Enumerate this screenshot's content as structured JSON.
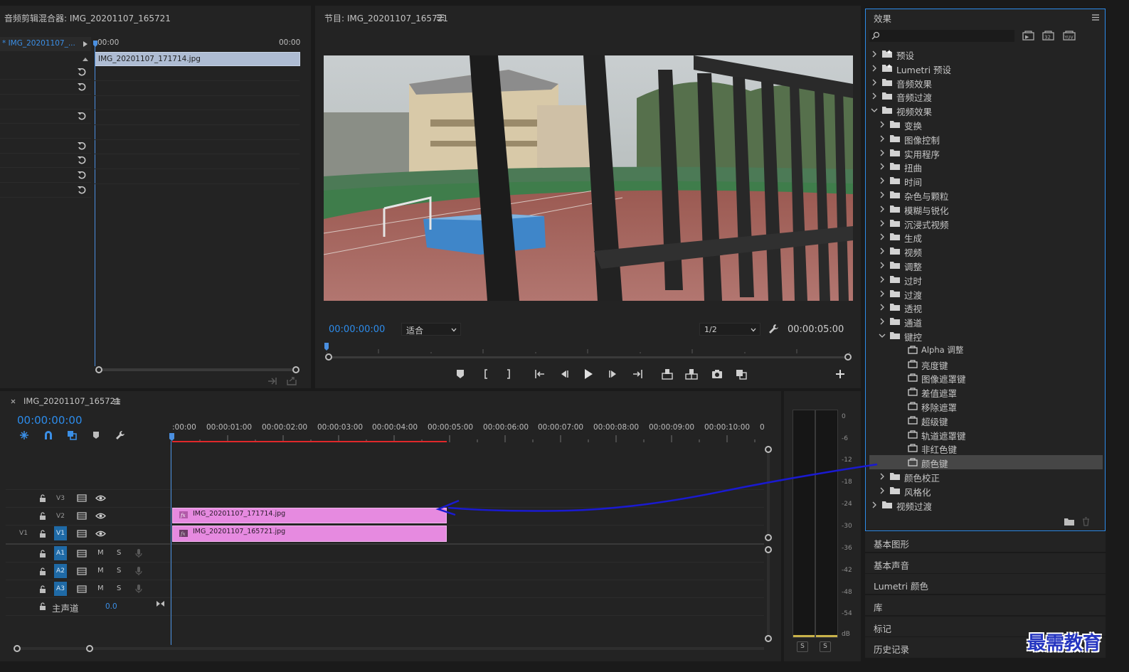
{
  "audio_mixer": {
    "title": "音频剪辑混合器: IMG_20201107_165721",
    "sequence_item": "* IMG_20201107_...",
    "time_start": "00:00",
    "time_end": "00:00",
    "clip_name": "IMG_20201107_171714.jpg"
  },
  "program": {
    "title": "节目: IMG_20201107_165721",
    "timecode": "00:00:00:00",
    "zoom_select": "适合",
    "resolution_select": "1/2",
    "duration": "00:00:05:00"
  },
  "effects": {
    "title": "效果",
    "search_placeholder": "",
    "items": [
      {
        "label": "预设",
        "level": 0,
        "expanded": false,
        "kind": "special-folder"
      },
      {
        "label": "Lumetri 预设",
        "level": 0,
        "expanded": false,
        "kind": "special-folder"
      },
      {
        "label": "音频效果",
        "level": 0,
        "expanded": false,
        "kind": "folder"
      },
      {
        "label": "音频过渡",
        "level": 0,
        "expanded": false,
        "kind": "folder"
      },
      {
        "label": "视频效果",
        "level": 0,
        "expanded": true,
        "kind": "folder"
      },
      {
        "label": "变换",
        "level": 1,
        "expanded": false,
        "kind": "folder"
      },
      {
        "label": "图像控制",
        "level": 1,
        "expanded": false,
        "kind": "folder"
      },
      {
        "label": "实用程序",
        "level": 1,
        "expanded": false,
        "kind": "folder"
      },
      {
        "label": "扭曲",
        "level": 1,
        "expanded": false,
        "kind": "folder"
      },
      {
        "label": "时间",
        "level": 1,
        "expanded": false,
        "kind": "folder"
      },
      {
        "label": "杂色与颗粒",
        "level": 1,
        "expanded": false,
        "kind": "folder"
      },
      {
        "label": "模糊与锐化",
        "level": 1,
        "expanded": false,
        "kind": "folder"
      },
      {
        "label": "沉浸式视频",
        "level": 1,
        "expanded": false,
        "kind": "folder"
      },
      {
        "label": "生成",
        "level": 1,
        "expanded": false,
        "kind": "folder"
      },
      {
        "label": "视频",
        "level": 1,
        "expanded": false,
        "kind": "folder"
      },
      {
        "label": "调整",
        "level": 1,
        "expanded": false,
        "kind": "folder"
      },
      {
        "label": "过时",
        "level": 1,
        "expanded": false,
        "kind": "folder"
      },
      {
        "label": "过渡",
        "level": 1,
        "expanded": false,
        "kind": "folder"
      },
      {
        "label": "透视",
        "level": 1,
        "expanded": false,
        "kind": "folder"
      },
      {
        "label": "通道",
        "level": 1,
        "expanded": false,
        "kind": "folder"
      },
      {
        "label": "键控",
        "level": 1,
        "expanded": true,
        "kind": "folder"
      },
      {
        "label": "Alpha 调整",
        "level": 2,
        "kind": "effect"
      },
      {
        "label": "亮度键",
        "level": 2,
        "kind": "effect"
      },
      {
        "label": "图像遮罩键",
        "level": 2,
        "kind": "effect"
      },
      {
        "label": "差值遮罩",
        "level": 2,
        "kind": "effect"
      },
      {
        "label": "移除遮罩",
        "level": 2,
        "kind": "effect"
      },
      {
        "label": "超级键",
        "level": 2,
        "kind": "effect"
      },
      {
        "label": "轨道遮罩键",
        "level": 2,
        "kind": "effect"
      },
      {
        "label": "非红色键",
        "level": 2,
        "kind": "effect"
      },
      {
        "label": "颜色键",
        "level": 2,
        "kind": "effect",
        "selected": true
      },
      {
        "label": "颜色校正",
        "level": 1,
        "expanded": false,
        "kind": "folder"
      },
      {
        "label": "风格化",
        "level": 1,
        "expanded": false,
        "kind": "folder"
      },
      {
        "label": "视频过渡",
        "level": 0,
        "expanded": false,
        "kind": "folder"
      }
    ]
  },
  "side_panels": [
    "基本图形",
    "基本声音",
    "Lumetri 颜色",
    "库",
    "标记",
    "历史记录"
  ],
  "timeline": {
    "tab_title": "IMG_20201107_165721",
    "timecode": "00:00:00:00",
    "ruler": [
      ":00:00",
      "00:00:01:00",
      "00:00:02:00",
      "00:00:03:00",
      "00:00:04:00",
      "00:00:05:00",
      "00:00:06:00",
      "00:00:07:00",
      "00:00:08:00",
      "00:00:09:00",
      "00:00:10:00",
      "0"
    ],
    "tracks": {
      "v3": "V3",
      "v2": "V2",
      "v1": "V1",
      "v1_source": "V1",
      "a1": "A1",
      "a2": "A2",
      "a3": "A3",
      "mute": "M",
      "solo": "S",
      "master_label": "主声道",
      "master_value": "0.0"
    },
    "clips": {
      "v2": "IMG_20201107_171714.jpg",
      "v1": "IMG_20201107_165721.jpg"
    }
  },
  "audio_meter": {
    "scale": [
      "0",
      "-6",
      "-12",
      "-18",
      "-24",
      "-30",
      "-36",
      "-42",
      "-48",
      "-54",
      "dB"
    ],
    "solo_left": "S",
    "solo_right": "S"
  },
  "watermark": "最需教育",
  "colors": {
    "accent_blue": "#2d8ceb",
    "clip_pink": "#e68ae0",
    "track_active": "#1f6aa6",
    "playhead": "#4a8fe0",
    "work_area": "#e0282b",
    "annotation_arrow": "#1a1ad0"
  }
}
